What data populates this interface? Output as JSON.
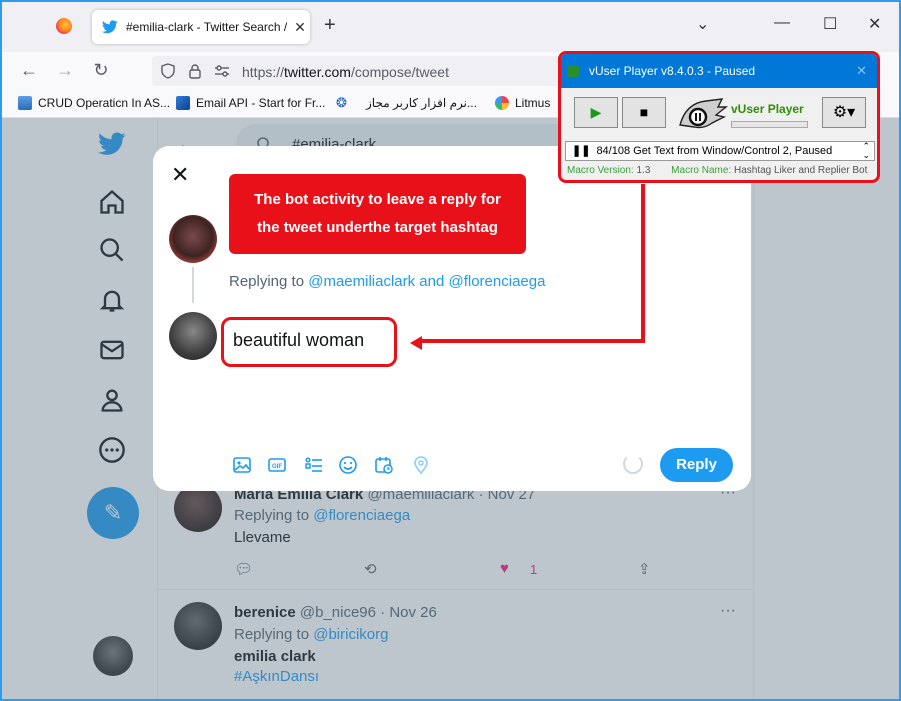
{
  "browser": {
    "tab_title": "#emilia-clark - Twitter Search /",
    "url_prefix": "https://",
    "url_domain": "twitter.com",
    "url_path": "/compose/tweet",
    "bookmarks": [
      {
        "label": "CRUD Operaticn In AS..."
      },
      {
        "label": "Email API - Start for Fr..."
      },
      {
        "label": "نرم افزار کاربر مجاز..."
      },
      {
        "label": "Litmus"
      }
    ]
  },
  "page": {
    "search_text": "#emilia-clark",
    "tweets": [
      {
        "name": "Maria Emilia Clark",
        "handle": "@maemiliaclark",
        "date": "· Nov 27",
        "replying_prefix": "Replying to",
        "replying_to": "@florenciaega",
        "text": "Llevame",
        "like_count": "1"
      },
      {
        "name": "berenice",
        "handle": "@b_nice96",
        "date": "· Nov 26",
        "replying_prefix": "Replying to",
        "replying_to": "@biricikorg",
        "text": "emilia clark",
        "hashtag": "#AşkınDansı"
      }
    ]
  },
  "modal": {
    "replying_prefix": "Replying to",
    "replying_to": "@maemiliaclark and @florenciaega",
    "reply_text": "beautiful woman",
    "reply_button": "Reply"
  },
  "annotation": {
    "line1": "The bot activity to leave a reply for",
    "line2": "the tweet underthe target hashtag"
  },
  "vuser": {
    "title": "vUser Player v8.4.0.3 - Paused",
    "brand": "vUser Player",
    "status": "84/108 Get Text from Window/Control 2, Paused",
    "macro_version_label": "Macro Version:",
    "macro_version": "1.3",
    "macro_name_label": "Macro Name:",
    "macro_name": "Hashtag Liker and Replier Bot"
  },
  "colors": {
    "twitter_blue": "#1d9bf0",
    "annotation_red": "#e8111a",
    "player_titlebar": "#0078d7",
    "player_green": "#2f8f00"
  }
}
